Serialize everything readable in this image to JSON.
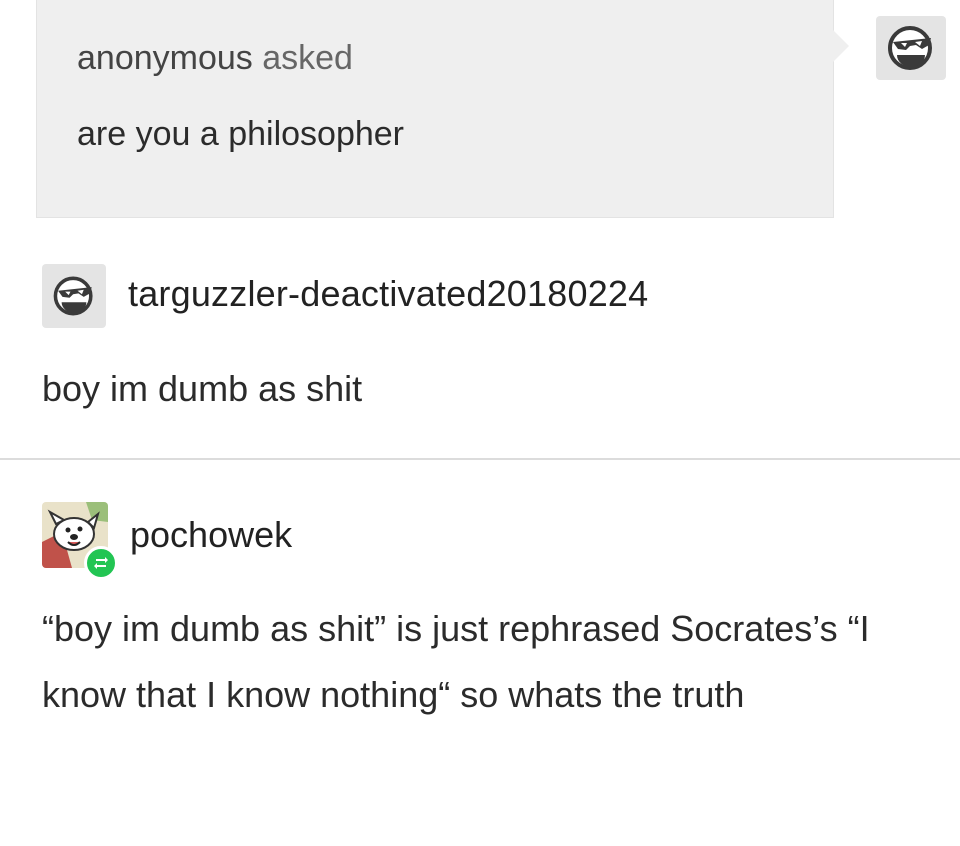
{
  "ask": {
    "asker": "anonymous",
    "verb": "asked",
    "question": "are you a philosopher",
    "answerer_avatar_icon": "sunglasses-face-icon"
  },
  "posts": [
    {
      "username": "targuzzler-deactivated20180224",
      "avatar_icon": "sunglasses-face-icon",
      "text": "boy im dumb as shit"
    },
    {
      "username": "pochowek",
      "avatar_icon": "cartoon-dog-avatar",
      "badge_icon": "reblog-icon",
      "text": "“boy im dumb as shit” is just rephrased Socrates’s “I know that I know nothing“ so whats the truth"
    }
  ],
  "colors": {
    "ask_bg": "#efefef",
    "reblog_badge": "#22c553",
    "divider": "#dcdcdc"
  }
}
